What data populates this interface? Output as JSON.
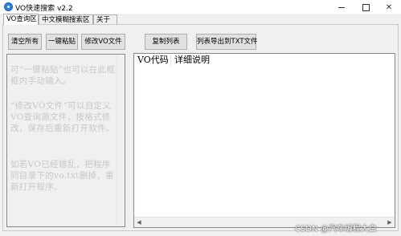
{
  "window": {
    "title": "VO快速搜索 v2.2",
    "min_symbol": "",
    "max_symbol": "",
    "close_symbol": "✕"
  },
  "tabs": [
    {
      "label": "VO查询区",
      "active": true
    },
    {
      "label": "中文模糊搜索区",
      "active": false
    },
    {
      "label": "关于",
      "active": false
    }
  ],
  "toolbar": {
    "clear_all": "清空所有",
    "one_click_paste": "一键粘贴",
    "edit_vo_file": "修改VO文件",
    "copy_list": "复制列表",
    "export_list_txt": "列表导出到TXT文件"
  },
  "input_area": {
    "hint_1": "可“一键粘贴”也可以在此框框内手动输入。",
    "hint_2": "“修改VO文件”可以自定义VO查询源文件，按格式修改，保存后重新打开软件。",
    "hint_3": "如若VO已经错乱，把程序同目录下的vo.txt删掉，重新打开程序。"
  },
  "result_list": {
    "columns": [
      "VO代码",
      "详细说明"
    ],
    "rows": []
  },
  "watermark": "CSDN @汽车编程大白",
  "colors": {
    "accent": "#2f7fd8",
    "hint_text": "#c8c8c8",
    "button_face": "#e1e1e1"
  }
}
